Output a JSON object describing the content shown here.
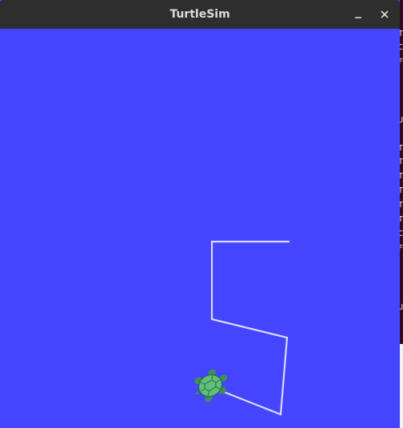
{
  "window": {
    "title": "TurtleSim",
    "minimize_icon": "minimize-icon",
    "close_icon": "close-icon"
  },
  "canvas": {
    "background_color": "#4545ff",
    "pen_color": "#d9d9ff",
    "turtle_icon": "turtle-icon",
    "turtle_color": "#5fbf7a"
  },
  "background_terminal": {
    "visible_chars": [
      "T",
      "C",
      "F",
      "U",
      "T",
      "T",
      "T",
      "T",
      "T",
      "T",
      "C",
      "F",
      "U"
    ]
  }
}
